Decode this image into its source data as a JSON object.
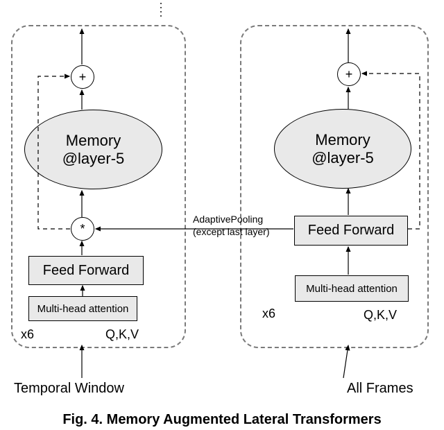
{
  "left": {
    "input_label": "Temporal Window",
    "qkv": "Q,K,V",
    "mha": "Multi-head attention",
    "ff": "Feed Forward",
    "merge": "*",
    "memory_line1": "Memory",
    "memory_line2": "@layer-5",
    "plus": "+",
    "repeat": "x6"
  },
  "right": {
    "input_label": "All Frames",
    "qkv": "Q,K,V",
    "mha": "Multi-head attention",
    "ff": "Feed Forward",
    "memory_line1": "Memory",
    "memory_line2": "@layer-5",
    "plus": "+",
    "repeat": "x6"
  },
  "lateral": {
    "label_line1": "AdaptivePooling",
    "label_line2": "(except last layer)"
  },
  "caption": "Fig. 4. Memory Augmented Lateral Transformers"
}
